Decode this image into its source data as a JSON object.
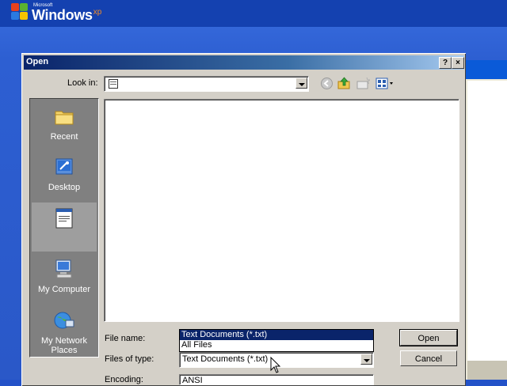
{
  "desktop": {
    "logo": {
      "microsoft": "Microsoft",
      "windows": "Windows",
      "version": "xp"
    }
  },
  "dialog": {
    "title": "Open",
    "help_button": "?",
    "close_button": "×",
    "look_in_label": "Look in:",
    "look_in_value": "",
    "toolbar": {
      "back": "back-icon",
      "up": "up-folder-icon",
      "new_folder": "new-folder-icon",
      "views": "views-menu-icon"
    },
    "places": [
      {
        "label": "Recent",
        "icon": "recent-folder-icon"
      },
      {
        "label": "Desktop",
        "icon": "desktop-icon"
      },
      {
        "label": "",
        "icon": "document-icon"
      },
      {
        "label": "My Computer",
        "icon": "my-computer-icon"
      },
      {
        "label": "My Network Places",
        "icon": "network-places-icon"
      }
    ],
    "file_name_label": "File name:",
    "files_of_type_label": "Files of type:",
    "encoding_label": "Encoding:",
    "file_type_value": "Text Documents (*.txt)",
    "file_type_options": [
      "Text Documents (*.txt)",
      "All Files"
    ],
    "encoding_value": "ANSI",
    "open_button": "Open",
    "cancel_button": "Cancel"
  },
  "colors": {
    "titlebar_start": "#0a246a",
    "titlebar_end": "#a6caf0",
    "dialog_face": "#d4d0c8",
    "selection": "#0a246a",
    "desktop": "#2a58c8"
  }
}
